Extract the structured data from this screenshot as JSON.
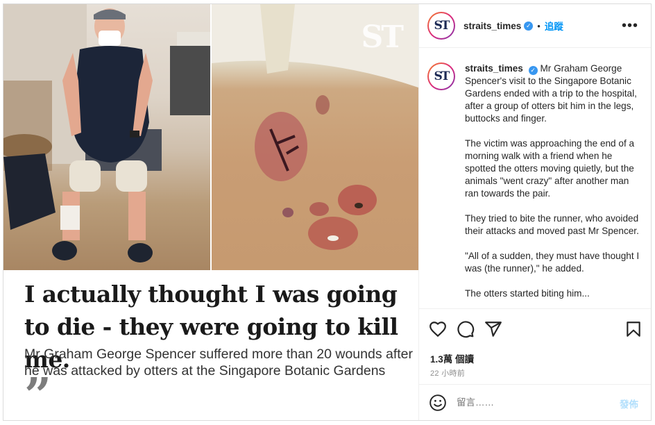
{
  "image": {
    "watermark": "ST",
    "headline": "I actually thought I was going to die - they were going to kill me.",
    "subhead": "Mr Graham George Spencer suffered more than 20 wounds after he was attacked by otters at the Singapore Botanic Gardens",
    "quote_glyph": "”"
  },
  "header": {
    "username": "straits_times",
    "verified": "✓",
    "separator": "•",
    "follow_label": "追蹤",
    "more_label": "•••"
  },
  "caption": {
    "username": "straits_times",
    "paragraphs": [
      "Mr Graham George Spencer's visit to the Singapore Botanic Gardens ended with a trip to the hospital, after a group of otters bit him in the legs, buttocks and finger.",
      "The victim was approaching the end of a morning walk with a friend when he spotted the otters moving quietly, but the animals \"went crazy\" after another man ran towards the pair.",
      "They tried to bite the runner, who avoided their attacks and moved past Mr Spencer.",
      "\"All of a sudden, they must have thought I was (the runner),\" he added.",
      "The otters started biting him..."
    ]
  },
  "stats": {
    "views": "1.3萬 個讀",
    "time": "22 小時前"
  },
  "comment": {
    "placeholder": "留言……",
    "post_label": "發佈"
  },
  "avatar_mark": "ST",
  "colors": {
    "accent": "#0095f6",
    "verified": "#3897f0",
    "post_disabled": "#b2dffc"
  },
  "icons": [
    "heart-icon",
    "comment-icon",
    "share-icon",
    "bookmark-icon",
    "emoji-icon",
    "more-icon",
    "verified-badge-icon"
  ]
}
